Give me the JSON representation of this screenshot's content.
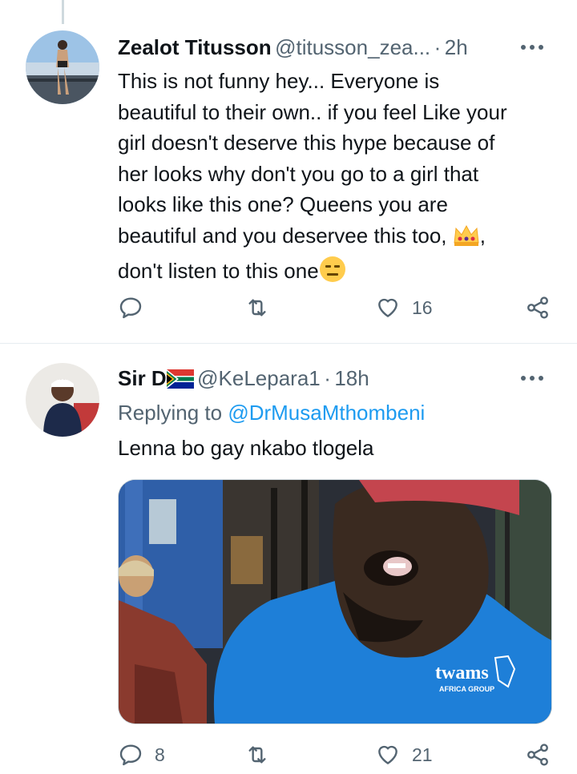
{
  "tweet1": {
    "display_name": "Zealot Titusson",
    "handle": "@titusson_zea...",
    "separator": "·",
    "time": "2h",
    "text_line1": "This is not funny hey... Everyone is",
    "text_line2": "beautiful to their own.. if you feel Like your",
    "text_line3": "girl doesn't deserve this hype because of",
    "text_line4": "her looks why don't you go to a girl that",
    "text_line5": "looks like this one? Queens you are",
    "text_line6_start": "beautiful and you deservee this too, ",
    "text_line6_end": ",",
    "text_line7": "don't listen to this one",
    "like_count": "16"
  },
  "tweet2": {
    "display_name": "Sir D",
    "handle": "@KeLepara1",
    "separator": "·",
    "time": "18h",
    "replying_prefix": "Replying to ",
    "replying_handle": "@DrMusaMthombeni",
    "text": "Lenna bo gay nkabo tlogela",
    "shirt_text": "twams",
    "shirt_sub": "AFRICA GROUP",
    "reply_count": "8",
    "like_count": "21"
  },
  "icons": [
    "reply-icon",
    "retweet-icon",
    "like-icon",
    "share-icon",
    "more-icon",
    "crown-emoji",
    "expressionless-emoji",
    "south-africa-flag"
  ],
  "colors": {
    "accent": "#1d9bf0",
    "muted": "#536471",
    "text": "#0f1419"
  }
}
